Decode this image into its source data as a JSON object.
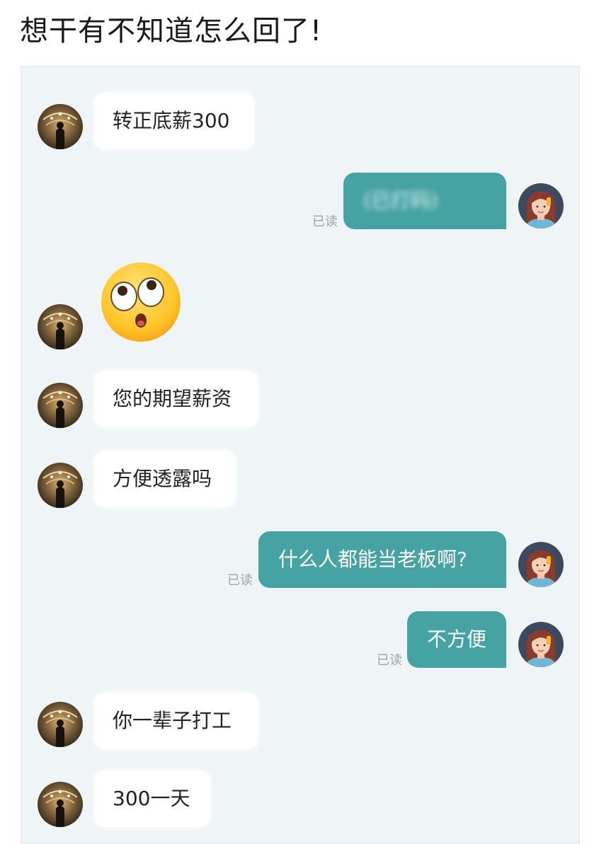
{
  "post": {
    "title": "想干有不知道怎么回了!"
  },
  "chat": {
    "read_label": "已读",
    "messages": [
      {
        "side": "in",
        "text": "转正底薪300"
      },
      {
        "side": "out",
        "text": "(已打码)",
        "read": true
      },
      {
        "side": "in",
        "emoji": "surprised-face-emoji"
      },
      {
        "side": "in",
        "text": "您的期望薪资"
      },
      {
        "side": "in",
        "text": "方便透露吗"
      },
      {
        "side": "out",
        "text": "什么人都能当老板啊?",
        "read": true
      },
      {
        "side": "out",
        "text": "不方便",
        "read": true
      },
      {
        "side": "in",
        "text": "你一辈子打工"
      },
      {
        "side": "in",
        "text": "300一天"
      }
    ]
  },
  "colors": {
    "chat_background": "#eff5f6",
    "outgoing_bubble": "#45a3a3",
    "incoming_bubble": "#ffffff",
    "read_label": "#9aa4a6"
  }
}
